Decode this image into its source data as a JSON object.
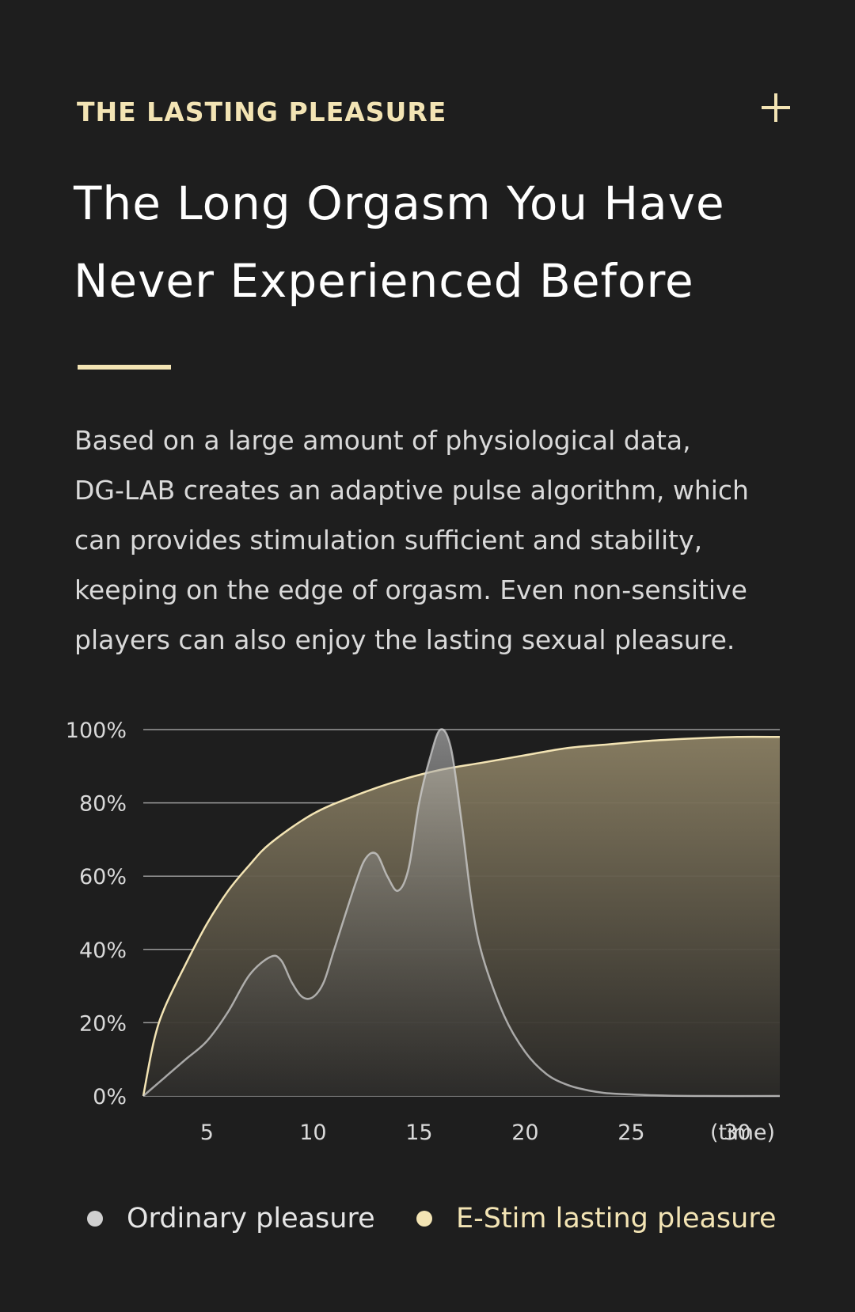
{
  "section": {
    "eyebrow": "THE LASTING PLEASURE",
    "expand_icon": "plus-icon",
    "headline_lines": [
      "The Long Orgasm You Have",
      "Never Experienced Before"
    ],
    "body_lines": [
      "Based on a large amount of physiological data,",
      "DG-LAB creates an adaptive pulse algorithm, which",
      "can provides stimulation sufficient and stability,",
      "keeping on the edge of orgasm. Even non-sensitive",
      "players can also enjoy the lasting sexual pleasure."
    ],
    "accent_color": "#f3e4b4",
    "background_color": "#1e1e1e"
  },
  "chart_data": {
    "type": "area",
    "title": "",
    "xlabel": "(time)",
    "ylabel": "",
    "xlim": [
      2,
      32
    ],
    "ylim": [
      0,
      100
    ],
    "x_ticks": [
      5,
      10,
      15,
      20,
      25,
      30
    ],
    "y_ticks": [
      0,
      20,
      40,
      60,
      80,
      100
    ],
    "y_tick_labels": [
      "0%",
      "20%",
      "40%",
      "60%",
      "80%",
      "100%"
    ],
    "grid": true,
    "legend": "bottom",
    "series": [
      {
        "name": "Ordinary pleasure",
        "color": "#d0d0d0",
        "x": [
          2,
          3,
          4,
          5,
          6,
          7,
          8,
          8.5,
          9,
          9.5,
          10,
          10.5,
          11,
          12,
          12.5,
          13,
          13.5,
          14,
          14.5,
          15,
          15.5,
          16,
          16.5,
          17,
          17.5,
          18,
          19,
          20,
          21,
          22,
          23,
          24,
          26,
          28,
          32
        ],
        "y": [
          0,
          5,
          10,
          15,
          23,
          33,
          38,
          37,
          31,
          27,
          27,
          31,
          40,
          58,
          65,
          66,
          60,
          56,
          62,
          80,
          92,
          100,
          95,
          75,
          52,
          38,
          22,
          12,
          6,
          3,
          1.5,
          0.7,
          0.2,
          0,
          0
        ]
      },
      {
        "name": "E-Stim lasting pleasure",
        "color": "#f3e4b4",
        "x": [
          2,
          2.5,
          3,
          4,
          5,
          6,
          7,
          8,
          10,
          12,
          14,
          16,
          18,
          20,
          22,
          24,
          26,
          28,
          30,
          32
        ],
        "y": [
          0,
          15,
          24,
          36,
          47,
          56,
          63,
          69,
          77,
          82,
          86,
          89,
          91,
          93,
          95,
          96,
          97,
          97.6,
          98,
          98
        ]
      }
    ]
  }
}
